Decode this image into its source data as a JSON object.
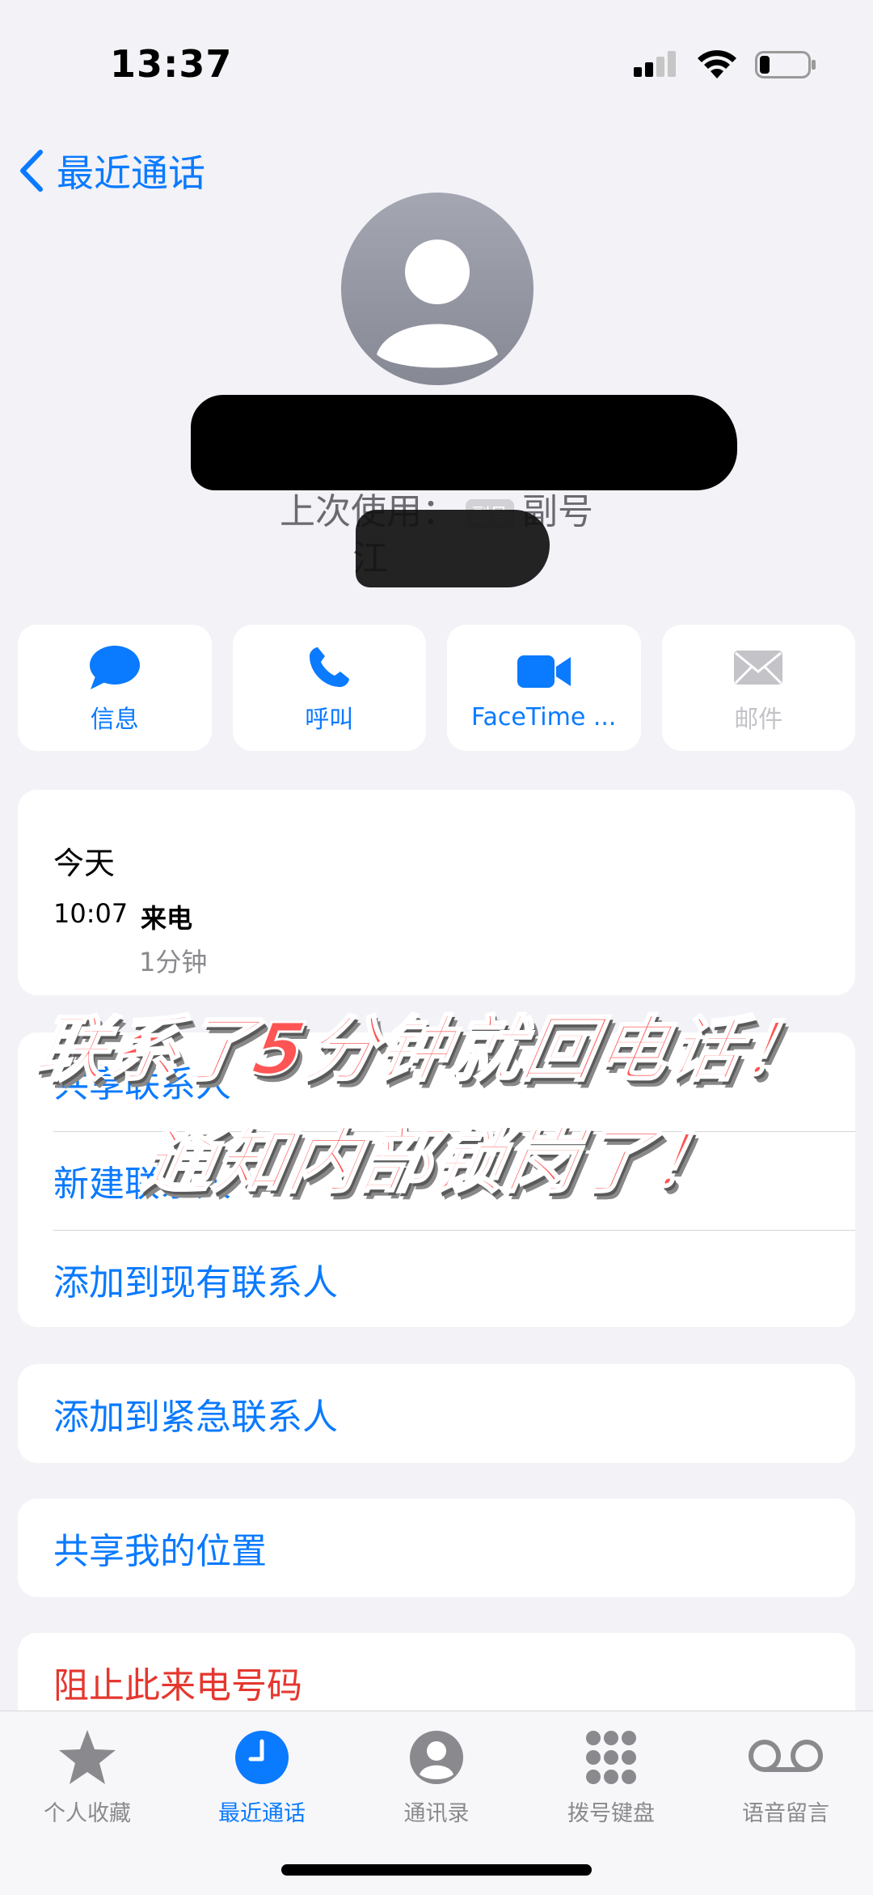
{
  "status": {
    "time": "13:37"
  },
  "nav": {
    "back_label": "最近通话"
  },
  "contact": {
    "last_used_prefix": "上次使用：",
    "line_chip": "副号",
    "line_name": "副号",
    "region": "江"
  },
  "actions": [
    {
      "label": "信息",
      "icon": "message-bubble-icon"
    },
    {
      "label": "呼叫",
      "icon": "phone-icon"
    },
    {
      "label": "FaceTime ...",
      "icon": "video-camera-icon"
    },
    {
      "label": "邮件",
      "icon": "mail-icon"
    }
  ],
  "history": {
    "day": "今天",
    "time": "10:07",
    "type": "来电",
    "duration": "1分钟"
  },
  "menu": {
    "share_contact": "共享联系人",
    "new_contact": "新建联系人",
    "add_existing": "添加到现有联系人",
    "add_emergency": "添加到紧急联系人",
    "share_location": "共享我的位置",
    "block_caller": "阻止此来电号码"
  },
  "overlay": {
    "line1": "联系了5分钟就回电话！",
    "line2": "通知内部锁岗了！"
  },
  "tabs": [
    {
      "label": "个人收藏",
      "icon": "star-icon"
    },
    {
      "label": "最近通话",
      "icon": "clock-icon"
    },
    {
      "label": "通讯录",
      "icon": "person-circle-icon"
    },
    {
      "label": "拨号键盘",
      "icon": "keypad-icon"
    },
    {
      "label": "语音留言",
      "icon": "voicemail-icon"
    }
  ],
  "colors": {
    "accent": "#0a7aff",
    "danger": "#e5372f",
    "overlay_text": "#ff5454"
  }
}
